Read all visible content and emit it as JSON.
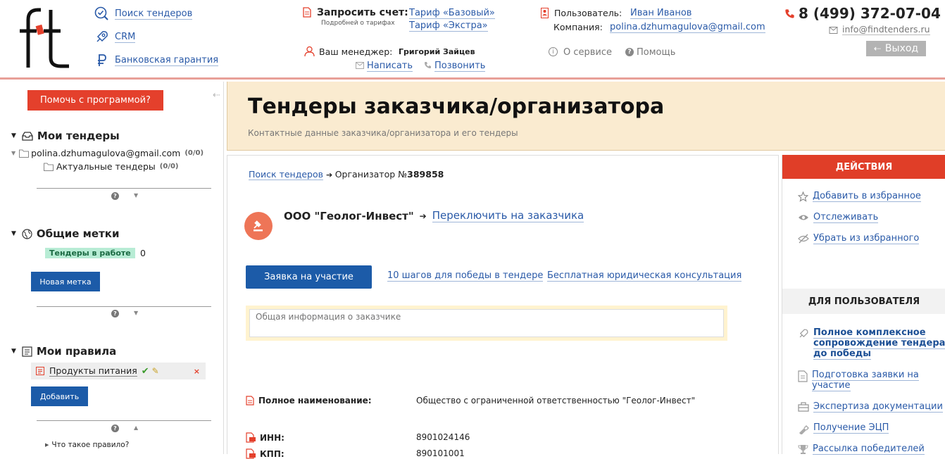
{
  "header": {
    "nav": [
      {
        "label": "Поиск тендеров",
        "icon": "search-icon"
      },
      {
        "label": "CRM",
        "icon": "rocket-icon"
      },
      {
        "label": "Банковская гарантия",
        "icon": "ruble-icon"
      }
    ],
    "invoice_label": "Запросить счет:",
    "tariff_note": "Подробней о тарифах",
    "tariff_basic": "Тариф «Базовый»",
    "tariff_extra": "Тариф «Экстра»",
    "manager_label": "Ваш менеджер:",
    "manager_name": "Григорий Зайцев",
    "write_label": "Написать",
    "call_label": "Позвонить",
    "user_label": "Пользователь:",
    "user_name": "Иван Иванов",
    "company_label": "Компания:",
    "company_email": "polina.dzhumagulova@gmail.com",
    "about_label": "О сервисе",
    "help_label": "Помощь",
    "phone": "8 (499) 372-07-04",
    "support_email": "info@findtenders.ru",
    "logout_label": "Выход"
  },
  "sidebar": {
    "help_button": "Помочь с программой?",
    "my_tenders_title": "Мои тендеры",
    "account_email": "polina.dzhumagulova@gmail.com",
    "account_count": "(0/0)",
    "current_tenders": "Актуальные тендеры",
    "current_count": "(0/0)",
    "common_tags_title": "Общие метки",
    "tag_label": "Тендеры в работе",
    "tag_count": "0",
    "new_tag_button": "Новая метка",
    "my_rules_title": "Мои правила",
    "rule_name": "Продукты питания",
    "add_button": "Добавить",
    "what_is_rule": "Что такое правило?"
  },
  "banner": {
    "title": "Тендеры заказчика/организатора",
    "subtitle": "Контактные данные заказчика/организатора и его тендеры"
  },
  "main": {
    "breadcrumb_link": "Поиск тендеров",
    "breadcrumb_current_prefix": "Организатор №",
    "breadcrumb_number": "389858",
    "org_name": "ООО \"Геолог-Инвест\"",
    "switch_label": "Переключить на заказчика",
    "apply_button": "Заявка на участие",
    "steps_link": "10 шагов для победы в тендере",
    "consult_link": "Бесплатная юридическая консультация",
    "info_placeholder": "Общая информация о заказчике",
    "details": [
      {
        "label": "Полное наименование:",
        "value": "Общество с ограниченной ответственностью \"Геолог-Инвест\""
      },
      {
        "label": "ИНН:",
        "value": "8901024146"
      },
      {
        "label": "КПП:",
        "value": "890101001"
      }
    ]
  },
  "actions": {
    "title": "ДЕЙСТВИЯ",
    "items": [
      "Добавить в избранное",
      "Отслеживать",
      "Убрать из избранного"
    ],
    "user_title": "ДЛЯ ПОЛЬЗОВАТЕЛЯ",
    "user_items": [
      "Полное комплексное сопровождение тендера до победы",
      "Подготовка заявки на участие",
      "Экспертиза документации",
      "Получение ЭЦП",
      "Рассылка победителей"
    ]
  },
  "colors": {
    "accent_red": "#e4402c",
    "primary_blue": "#1c5ba8",
    "banner_bg": "#faebd0",
    "tag_green": "#b8ecd5"
  }
}
